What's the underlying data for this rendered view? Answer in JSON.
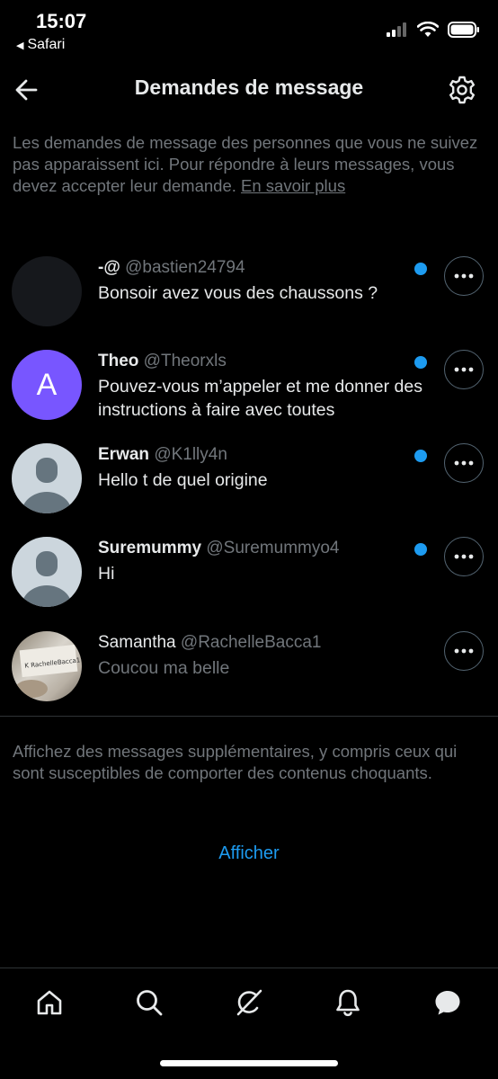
{
  "status_bar": {
    "time": "15:07",
    "back_app": "Safari"
  },
  "header": {
    "title": "Demandes de message"
  },
  "info": {
    "text": "Les demandes de message des personnes que vous ne suivez pas apparaissent ici. Pour répondre à leurs messages, vous devez accepter leur demande. ",
    "link": "En savoir plus"
  },
  "conversations": [
    {
      "name": "-@",
      "handle": "@bastien24794",
      "message": "Bonsoir avez vous des chaussons ?",
      "unread": true
    },
    {
      "name": "Theo",
      "handle": "@Theorxls",
      "message": "Pouvez-vous m’appeler et me donner des instructions à faire avec toutes",
      "unread": true,
      "avatar_letter": "A"
    },
    {
      "name": "Erwan",
      "handle": "@K1lly4n",
      "message": "Hello t de quel origine",
      "unread": true
    },
    {
      "name": "Suremummy",
      "handle": "@Suremummyo4",
      "message": "Hi",
      "unread": true
    },
    {
      "name": "Samantha",
      "handle": "@RachelleBacca1",
      "message": "Coucou ma belle",
      "unread": false,
      "avatar_caption": "K RachelleBacca1"
    }
  ],
  "more_info": "Affichez des messages supplémentaires, y compris ceux qui sont susceptibles de comporter des contenus choquants.",
  "show_button": "Afficher",
  "colors": {
    "accent": "#1d9bf0",
    "background": "#000000",
    "muted_text": "#71767b",
    "theo_avatar": "#7856ff"
  },
  "tabbar": [
    "home-icon",
    "search-icon",
    "grok-icon",
    "notifications-icon",
    "messages-icon"
  ]
}
